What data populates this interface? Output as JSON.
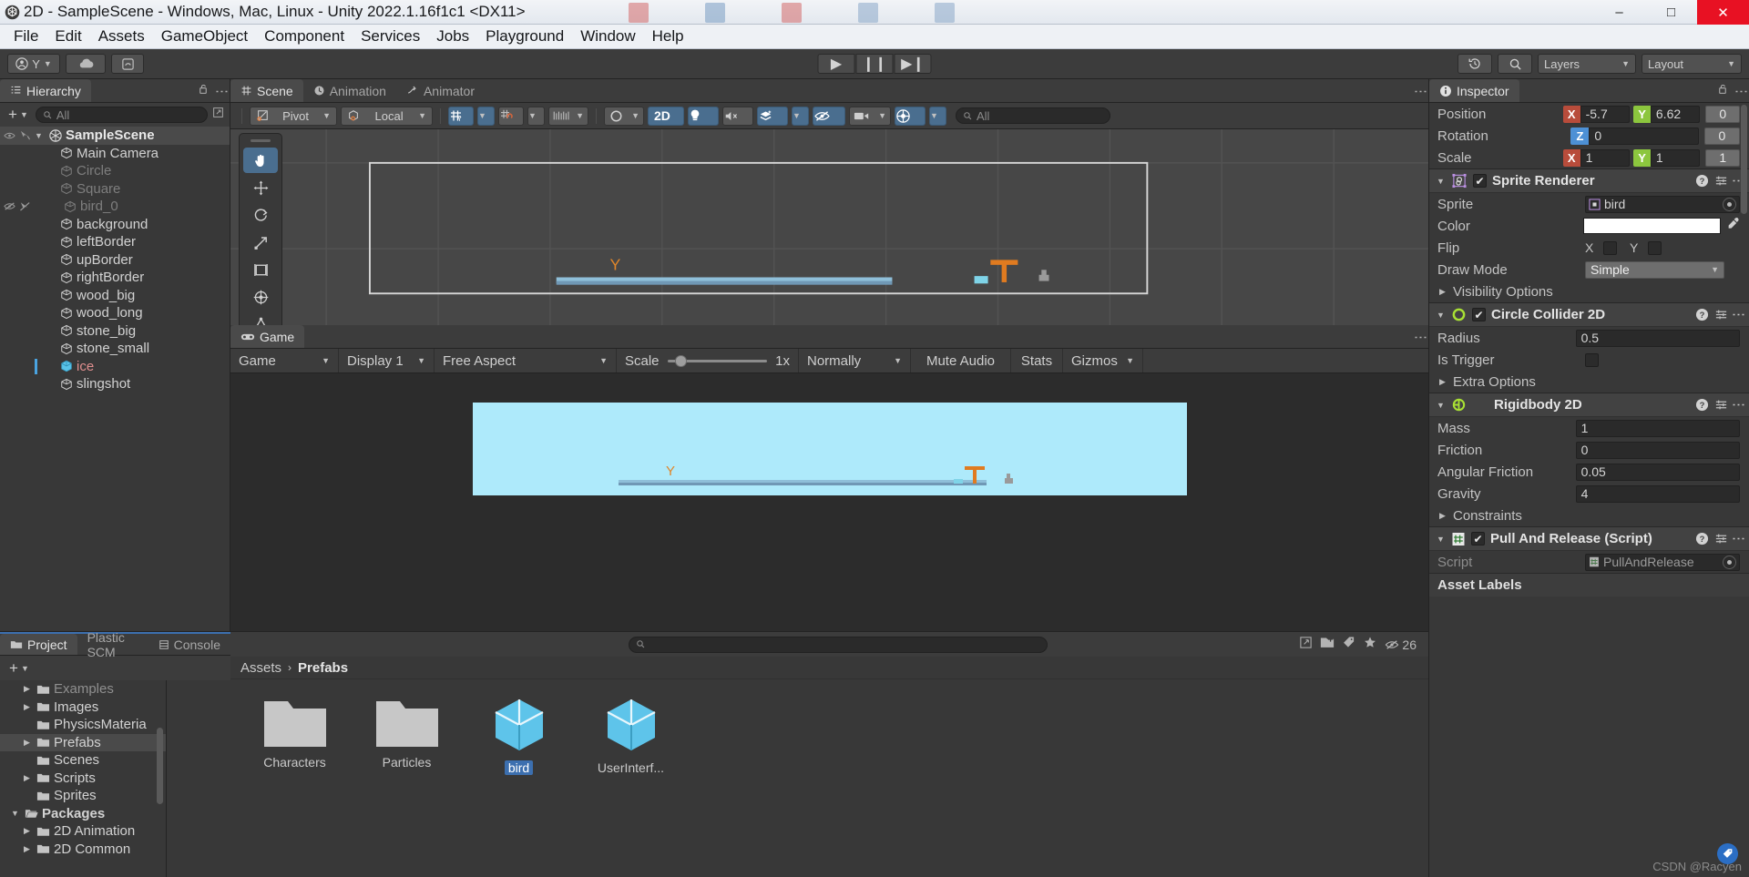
{
  "window": {
    "title": "2D - SampleScene - Windows, Mac, Linux - Unity 2022.1.16f1c1 <DX11>",
    "minimize": "–",
    "maximize": "□",
    "close": "✕"
  },
  "menubar": [
    "File",
    "Edit",
    "Assets",
    "GameObject",
    "Component",
    "Services",
    "Jobs",
    "Playground",
    "Window",
    "Help"
  ],
  "toolbar": {
    "account_label": "Y",
    "cloud_label": "cloud-icon",
    "collab_label": "collab-icon",
    "play": "▶",
    "pause": "❙❙",
    "step": "▶❙",
    "undo_history": "history-icon",
    "search": "search-icon",
    "layers": "Layers",
    "layout": "Layout"
  },
  "hierarchy": {
    "tab": "Hierarchy",
    "search_placeholder": "All",
    "add_label": "+",
    "items": [
      {
        "name": "SampleScene",
        "depth": 0,
        "style": "bold",
        "selected": true,
        "scene": true,
        "expanded": true
      },
      {
        "name": "Main Camera",
        "depth": 1,
        "style": "normal"
      },
      {
        "name": "Circle",
        "depth": 1,
        "style": "dim"
      },
      {
        "name": "Square",
        "depth": 1,
        "style": "dim"
      },
      {
        "name": "bird_0",
        "depth": 1,
        "style": "dim",
        "hidden_icons": true
      },
      {
        "name": "background",
        "depth": 1,
        "style": "normal"
      },
      {
        "name": "leftBorder",
        "depth": 1,
        "style": "normal"
      },
      {
        "name": "upBorder",
        "depth": 1,
        "style": "normal"
      },
      {
        "name": "rightBorder",
        "depth": 1,
        "style": "normal"
      },
      {
        "name": "wood_big",
        "depth": 1,
        "style": "normal"
      },
      {
        "name": "wood_long",
        "depth": 1,
        "style": "normal"
      },
      {
        "name": "stone_big",
        "depth": 1,
        "style": "normal"
      },
      {
        "name": "stone_small",
        "depth": 1,
        "style": "normal"
      },
      {
        "name": "ice",
        "depth": 1,
        "style": "prefab",
        "active": true
      },
      {
        "name": "slingshot",
        "depth": 1,
        "style": "normal"
      }
    ]
  },
  "scene": {
    "tabs": [
      {
        "label": "Scene",
        "icon": "grid-icon",
        "active": true
      },
      {
        "label": "Animation",
        "icon": "clock-icon",
        "active": false
      },
      {
        "label": "Animator",
        "icon": "arrow-branch-icon",
        "active": false
      }
    ],
    "tools": {
      "pivot": "Pivot",
      "local": "Local",
      "search_placeholder": "All",
      "two_d": "2D"
    },
    "overlay_tools": [
      "hand-tool",
      "move-tool",
      "rotate-tool",
      "scale-tool",
      "rect-tool",
      "transform-tool",
      "custom-tool"
    ]
  },
  "game": {
    "tab": "Game",
    "view_mode": "Game",
    "display": "Display 1",
    "aspect": "Free Aspect",
    "scale_label": "Scale",
    "scale_value": "1x",
    "scale_percent": 8,
    "play_mode": "Normally",
    "mute_audio": "Mute Audio",
    "stats": "Stats",
    "gizmos": "Gizmos"
  },
  "project": {
    "tabs": [
      {
        "label": "Project",
        "icon": "folder-icon",
        "active": true
      },
      {
        "label": "Plastic SCM",
        "icon": "",
        "active": false
      },
      {
        "label": "Console",
        "icon": "console-icon",
        "active": false
      }
    ],
    "search_placeholder": "",
    "badge_count": "26",
    "breadcrumb": [
      "Assets",
      "Prefabs"
    ],
    "tree": [
      {
        "name": "Examples",
        "depth": 1,
        "arrow": "▶",
        "partial": true
      },
      {
        "name": "Images",
        "depth": 1,
        "arrow": "▶"
      },
      {
        "name": "PhysicsMateria",
        "depth": 1,
        "arrow": ""
      },
      {
        "name": "Prefabs",
        "depth": 1,
        "arrow": "▶",
        "selected": true
      },
      {
        "name": "Scenes",
        "depth": 1,
        "arrow": ""
      },
      {
        "name": "Scripts",
        "depth": 1,
        "arrow": "▶"
      },
      {
        "name": "Sprites",
        "depth": 1,
        "arrow": ""
      },
      {
        "name": "Packages",
        "depth": 0,
        "arrow": "▼",
        "bold": true,
        "open_folder": true
      },
      {
        "name": "2D Animation",
        "depth": 1,
        "arrow": "▶"
      },
      {
        "name": "2D Common",
        "depth": 1,
        "arrow": "▶"
      }
    ],
    "assets": [
      {
        "name": "Characters",
        "type": "folder",
        "selected": false
      },
      {
        "name": "Particles",
        "type": "folder",
        "selected": false
      },
      {
        "name": "bird",
        "type": "prefab",
        "selected": true
      },
      {
        "name": "UserInterf...",
        "type": "prefab",
        "selected": false
      }
    ]
  },
  "inspector": {
    "tab": "Inspector",
    "transform": {
      "position": {
        "label": "Position",
        "x": "-5.7",
        "y": "6.62",
        "z": "0"
      },
      "rotation": {
        "label": "Rotation",
        "z": "0",
        "extra": "0"
      },
      "scale": {
        "label": "Scale",
        "x": "1",
        "y": "1",
        "z": "1"
      }
    },
    "components": [
      {
        "name": "Sprite Renderer",
        "icon": "sprite-renderer-icon",
        "enabled": true,
        "fields": [
          {
            "label": "Sprite",
            "type": "object",
            "value": "bird"
          },
          {
            "label": "Color",
            "type": "color",
            "value": "#FFFFFF"
          },
          {
            "label": "Flip",
            "type": "flip",
            "x_label": "X",
            "y_label": "Y",
            "x": false,
            "y": false
          },
          {
            "label": "Draw Mode",
            "type": "dropdown",
            "value": "Simple"
          },
          {
            "label": "Visibility Options",
            "type": "foldout"
          }
        ]
      },
      {
        "name": "Circle Collider 2D",
        "icon": "circle-collider-icon",
        "enabled": true,
        "fields": [
          {
            "label": "Radius",
            "type": "text",
            "value": "0.5"
          },
          {
            "label": "Is Trigger",
            "type": "checkbox",
            "value": false
          },
          {
            "label": "Extra Options",
            "type": "foldout"
          }
        ]
      },
      {
        "name": "Rigidbody 2D",
        "icon": "rigidbody-icon",
        "enabled": null,
        "fields": [
          {
            "label": "Mass",
            "type": "text",
            "value": "1"
          },
          {
            "label": "Friction",
            "type": "text",
            "value": "0"
          },
          {
            "label": "Angular Friction",
            "type": "text",
            "value": "0.05"
          },
          {
            "label": "Gravity",
            "type": "text",
            "value": "4"
          },
          {
            "label": "Constraints",
            "type": "foldout"
          }
        ]
      },
      {
        "name": "Pull And Release (Script)",
        "icon": "script-icon",
        "enabled": true,
        "fields": [
          {
            "label": "Script",
            "type": "object-dim",
            "value": "PullAndRelease"
          }
        ]
      }
    ],
    "asset_labels": "Asset Labels",
    "watermark": "CSDN @Racyen"
  }
}
